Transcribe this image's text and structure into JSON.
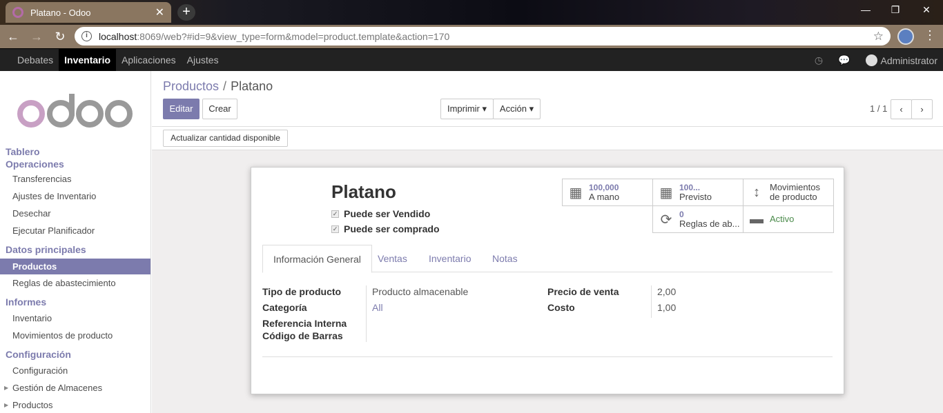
{
  "browser": {
    "tab_title": "Platano - Odoo",
    "new_tab": "+",
    "url_host": "localhost",
    "url_rest": ":8069/web?#id=9&view_type=form&model=product.template&action=170"
  },
  "topnav": {
    "items": [
      "Debates",
      "Inventario",
      "Aplicaciones",
      "Ajustes"
    ],
    "user": "Administrator"
  },
  "sidebar": {
    "logo_text": "odoo",
    "sections": [
      {
        "title": "Tablero",
        "items": []
      },
      {
        "title": "Operaciones",
        "items": [
          "Transferencias",
          "Ajustes de Inventario",
          "Desechar",
          "Ejecutar Planificador"
        ]
      },
      {
        "title": "Datos principales",
        "items": [
          "Productos",
          "Reglas de abastecimiento"
        ]
      },
      {
        "title": "Informes",
        "items": [
          "Inventario",
          "Movimientos de producto"
        ]
      },
      {
        "title": "Configuración",
        "items": [
          "Configuración",
          "Gestión de Almacenes",
          "Productos"
        ]
      }
    ]
  },
  "breadcrumb": {
    "parent": "Productos",
    "sep": "/",
    "current": "Platano"
  },
  "buttons": {
    "edit": "Editar",
    "create": "Crear",
    "print": "Imprimir",
    "action": "Acción",
    "update_qty": "Actualizar cantidad disponible"
  },
  "pager": {
    "text": "1 / 1"
  },
  "product": {
    "name": "Platano",
    "can_be_sold": "Puede ser Vendido",
    "can_be_purchased": "Puede ser comprado"
  },
  "smart_buttons": {
    "on_hand_value": "100,000",
    "on_hand_label": "A mano",
    "forecast_value": "100...",
    "forecast_label": "Previsto",
    "moves_line1": "Movimientos",
    "moves_line2": "de producto",
    "rules_value": "0",
    "rules_label": "Reglas de ab...",
    "active_label": "Activo"
  },
  "tabs": [
    "Información General",
    "Ventas",
    "Inventario",
    "Notas"
  ],
  "fields": {
    "type_label": "Tipo de producto",
    "type_value": "Producto almacenable",
    "category_label": "Categoría",
    "category_value": "All",
    "ref_label": "Referencia Interna",
    "barcode_label": "Código de Barras",
    "price_label": "Precio de venta",
    "price_value": "2,00",
    "cost_label": "Costo",
    "cost_value": "1,00"
  }
}
